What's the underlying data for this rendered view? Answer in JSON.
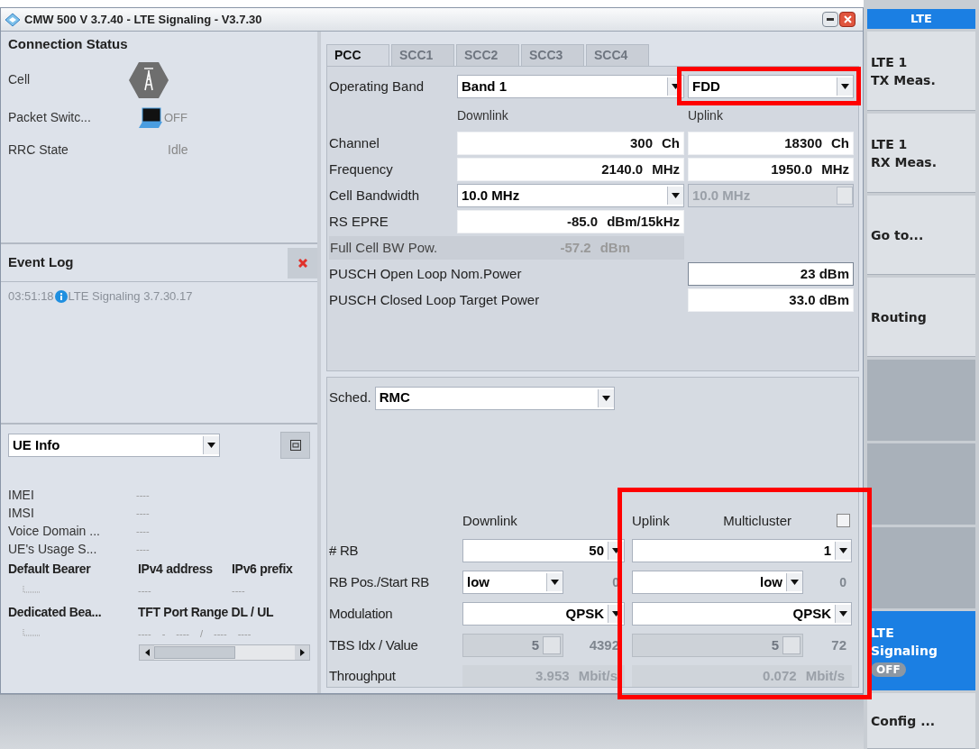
{
  "window": {
    "title": "CMW 500 V 3.7.40 - LTE Signaling  - V3.7.30"
  },
  "connection_status": {
    "title": "Connection Status",
    "rows": [
      {
        "kind": "cell",
        "label": "Cell"
      },
      {
        "kind": "packet",
        "label": "Packet Switc...",
        "value": "OFF"
      },
      {
        "kind": "text",
        "label": "RRC State",
        "value": "Idle"
      }
    ]
  },
  "event_log": {
    "title": "Event Log",
    "entries": [
      {
        "time": "03:51:18",
        "text": "LTE Signaling 3.7.30.17"
      }
    ]
  },
  "ue_info": {
    "selector": "UE Info",
    "rows": [
      {
        "label": "IMEI",
        "value": "----"
      },
      {
        "label": "IMSI",
        "value": "----"
      },
      {
        "label": "Voice Domain ...",
        "value": "----"
      },
      {
        "label": "UE's Usage S...",
        "value": "----"
      }
    ],
    "default_bearer": {
      "headers": [
        "Default Bearer",
        "IPv4 address",
        "IPv6 prefix"
      ],
      "values": [
        "----",
        "----"
      ]
    },
    "dedicated_bearer": {
      "headers": [
        "Dedicated Bea...",
        "TFT Port Range DL / UL"
      ],
      "values": [
        "----",
        "-",
        "----",
        "/",
        "----",
        "----"
      ]
    }
  },
  "tabs": [
    {
      "label": "PCC",
      "selected": true
    },
    {
      "label": "SCC1",
      "selected": false
    },
    {
      "label": "SCC2",
      "selected": false
    },
    {
      "label": "SCC3",
      "selected": false
    },
    {
      "label": "SCC4",
      "selected": false
    }
  ],
  "cell_settings": {
    "operating_band": {
      "label": "Operating Band",
      "value": "Band 1",
      "mode": "FDD",
      "mode_highlighted": true
    },
    "headers": [
      "Downlink",
      "Uplink"
    ],
    "rows": [
      {
        "label": "Channel",
        "downlink": {
          "kind": "field",
          "value": "300",
          "unit": "Ch"
        },
        "uplink": {
          "kind": "field",
          "value": "18300",
          "unit": "Ch"
        }
      },
      {
        "label": "Frequency",
        "downlink": {
          "kind": "field",
          "value": "2140.0",
          "unit": "MHz"
        },
        "uplink": {
          "kind": "field",
          "value": "1950.0",
          "unit": "MHz"
        }
      },
      {
        "label": "Cell Bandwidth",
        "downlink": {
          "kind": "dropdown",
          "value": "10.0 MHz",
          "disabled": false
        },
        "uplink": {
          "kind": "dropdown",
          "value": "10.0 MHz",
          "disabled": true
        }
      },
      {
        "label": "RS EPRE",
        "downlink": {
          "kind": "field",
          "value": "-85.0",
          "unit": "dBm/15kHz"
        }
      },
      {
        "label": "Full Cell BW Pow.",
        "readout": {
          "value": "-57.2",
          "unit": "dBm"
        }
      },
      {
        "label": "PUSCH Open Loop Nom.Power",
        "uplink": {
          "kind": "field",
          "value": "23 dBm",
          "focused": true
        }
      },
      {
        "label": "PUSCH Closed Loop Target Power",
        "uplink": {
          "kind": "field",
          "value": "33.0 dBm",
          "focused": false
        }
      }
    ]
  },
  "scheduling": {
    "label": "Sched.",
    "value": "RMC"
  },
  "rmc": {
    "downlink_header": "Downlink",
    "uplink_header": "Uplink",
    "multicluster": {
      "label": "Multicluster",
      "checked": false
    },
    "uplink_highlighted": true,
    "rows": [
      {
        "label": "# RB",
        "downlink": {
          "kind": "dropdown",
          "value": "50"
        },
        "uplink": {
          "kind": "dropdown",
          "value": "1"
        }
      },
      {
        "label": "RB Pos./Start RB",
        "downlink": {
          "kind": "dropdown-pair",
          "value": "low",
          "extra": "0"
        },
        "uplink": {
          "kind": "dropdown-pair",
          "value": "low",
          "extra": "0"
        }
      },
      {
        "label": "Modulation",
        "downlink": {
          "kind": "dropdown",
          "value": "QPSK"
        },
        "uplink": {
          "kind": "dropdown",
          "value": "QPSK"
        }
      },
      {
        "label": "TBS Idx / Value",
        "downlink": {
          "kind": "spin-pair",
          "value": "5",
          "extra": "4392"
        },
        "uplink": {
          "kind": "spin-pair",
          "value": "5",
          "extra": "72"
        }
      },
      {
        "label": "Throughput",
        "downlink": {
          "kind": "readout",
          "value": "3.953",
          "unit": "Mbit/s"
        },
        "uplink": {
          "kind": "readout",
          "value": "0.072",
          "unit": "Mbit/s"
        }
      }
    ]
  },
  "softkeys": {
    "header": "LTE",
    "top": [
      {
        "lines": [
          "LTE 1",
          "TX Meas."
        ],
        "active": false
      },
      {
        "lines": [
          "LTE 1",
          "RX Meas."
        ],
        "active": false
      },
      {
        "lines": [
          "Go to..."
        ],
        "active": false
      },
      {
        "lines": [
          "Routing"
        ],
        "active": false
      }
    ],
    "bottom": [
      {
        "lines": [
          "LTE",
          "Signaling"
        ],
        "status": "OFF",
        "active": true
      },
      {
        "lines": [
          "Config ..."
        ],
        "active": false
      }
    ]
  }
}
